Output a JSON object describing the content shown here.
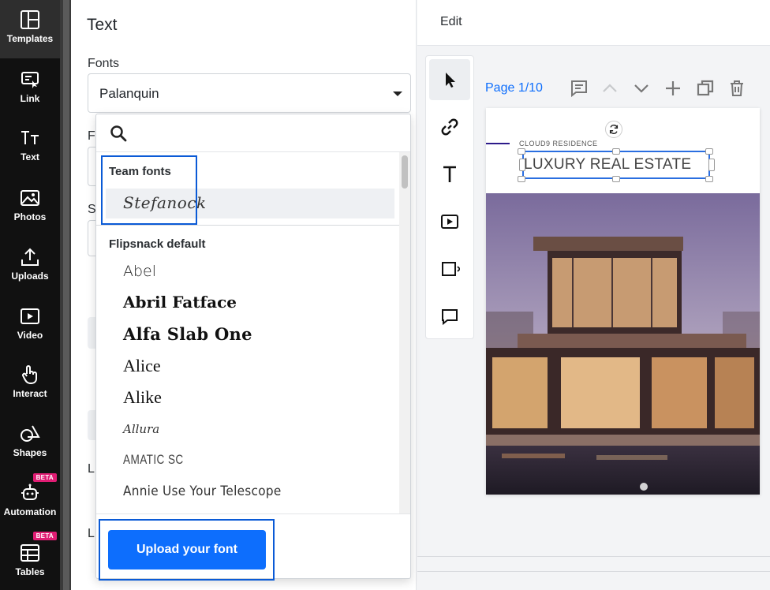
{
  "nav": {
    "items": [
      {
        "label": "Templates",
        "icon": "templates-icon"
      },
      {
        "label": "Link",
        "icon": "link-icon"
      },
      {
        "label": "Text",
        "icon": "text-icon"
      },
      {
        "label": "Photos",
        "icon": "photos-icon"
      },
      {
        "label": "Uploads",
        "icon": "uploads-icon"
      },
      {
        "label": "Video",
        "icon": "video-icon"
      },
      {
        "label": "Interact",
        "icon": "interact-icon"
      },
      {
        "label": "Shapes",
        "icon": "shapes-icon"
      },
      {
        "label": "Automation",
        "icon": "automation-icon",
        "badge": "BETA"
      },
      {
        "label": "Tables",
        "icon": "tables-icon",
        "badge": "BETA"
      }
    ]
  },
  "panel": {
    "title": "Text",
    "fonts_label": "Fonts",
    "selected_font": "Palanquin",
    "peek_labels": [
      "F",
      "S",
      "L",
      "L"
    ]
  },
  "dropdown": {
    "team_fonts_label": "Team fonts",
    "team_fonts": [
      "Stefanock"
    ],
    "default_label": "Flipsnack default",
    "default_fonts": [
      "Abel",
      "Abril Fatface",
      "Alfa Slab One",
      "Alice",
      "Alike",
      "Allura",
      "AMATIC SC",
      "Annie Use Your Telescope"
    ],
    "upload_label": "Upload your font"
  },
  "editor": {
    "edit_label": "Edit",
    "page_indicator": "Page 1/10",
    "page_subtitle": "CLOUD9 RESIDENCE",
    "page_title": "LUXURY REAL ESTATE"
  },
  "colors": {
    "accent": "#0d6efd",
    "highlight": "#0a5ad6",
    "beta": "#e11d74"
  }
}
